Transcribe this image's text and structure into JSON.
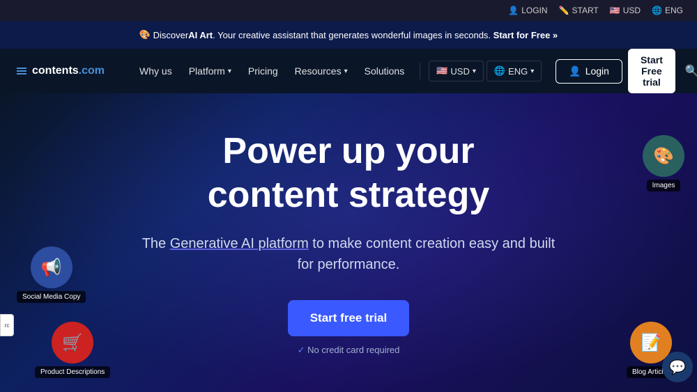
{
  "topbar": {
    "login_label": "LOGIN",
    "start_label": "START",
    "usd_label": "USD",
    "eng_label": "ENG"
  },
  "announcement": {
    "emoji": "🎨",
    "text_before": "Discover ",
    "highlight": "AI Art",
    "text_after": ". Your creative assistant that generates wonderful images in seconds.",
    "cta": "Start for Free »"
  },
  "navbar": {
    "logo_text": "contents",
    "logo_suffix": ".com",
    "why_us": "Why us",
    "platform": "Platform",
    "pricing": "Pricing",
    "resources": "Resources",
    "solutions": "Solutions",
    "usd": "USD",
    "eng": "ENG",
    "login": "Login",
    "start_trial": "Start Free trial"
  },
  "hero": {
    "title_line1": "Power up your",
    "title_line2": "content strategy",
    "subtitle_before": "The ",
    "subtitle_link": "Generative AI platform",
    "subtitle_after": " to make content creation easy and built for performance.",
    "cta_button": "Start free trial",
    "no_cc": "No credit card required"
  },
  "badges": {
    "social_media": {
      "label": "Social Media Copy",
      "icon": "📢"
    },
    "product": {
      "label": "Product Descriptions",
      "icon": "🛒"
    },
    "images": {
      "label": "Images",
      "icon": "🎨"
    },
    "blog": {
      "label": "Blog Articles",
      "icon": "📝"
    }
  }
}
